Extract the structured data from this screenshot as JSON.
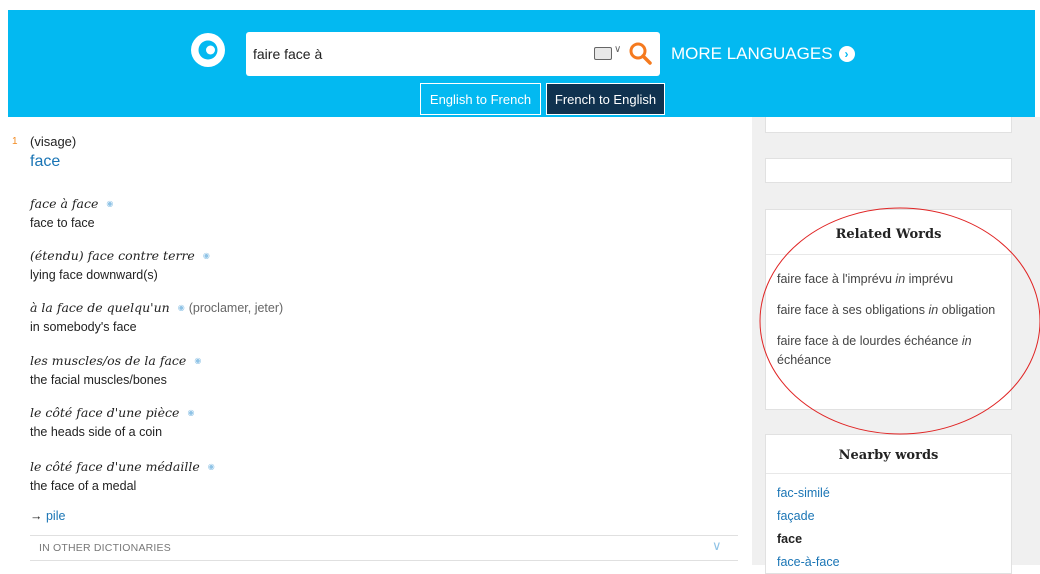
{
  "header": {
    "search": {
      "value": "faire face à",
      "placeholder": ""
    },
    "more_languages": "MORE LANGUAGES",
    "tabs": [
      "English to French",
      "French to English"
    ],
    "active_tab": "French to English",
    "accent_color": "#03b9f1"
  },
  "entry": {
    "sense_number": "1",
    "sense_label": "(visage)",
    "headword": "face",
    "examples": [
      {
        "phrase": "face à face",
        "context": "",
        "translation": "face to face"
      },
      {
        "phrase": "(étendu) face contre terre",
        "context": "",
        "translation": "lying face downward(s)"
      },
      {
        "phrase": "à la face de quelqu'un",
        "context": "(proclamer, jeter)",
        "translation": "in somebody's face"
      },
      {
        "phrase": "les muscles/os de la face",
        "context": "",
        "translation": "the facial muscles/bones"
      },
      {
        "phrase": "le côté face d'une pièce",
        "context": "",
        "translation": "the heads side of a coin"
      },
      {
        "phrase": "le côté face d'une médaille",
        "context": "",
        "translation": "the face of a medal"
      }
    ],
    "xref_arrow": "→",
    "xref_link": "pile",
    "other_dictionaries": "IN OTHER DICTIONARIES"
  },
  "sidebar": {
    "related_title": "Related Words",
    "related": [
      {
        "text": "faire face à l'imprévu",
        "in": "in",
        "word": "imprévu"
      },
      {
        "text": "faire face à ses obligations",
        "in": "in",
        "word": "obligation"
      },
      {
        "text": "faire face à de lourdes échéance",
        "in": "in",
        "word": "échéance"
      }
    ],
    "nearby_title": "Nearby words",
    "nearby": [
      "fac-similé",
      "façade",
      "face",
      "face-à-face"
    ],
    "nearby_current": "face"
  }
}
